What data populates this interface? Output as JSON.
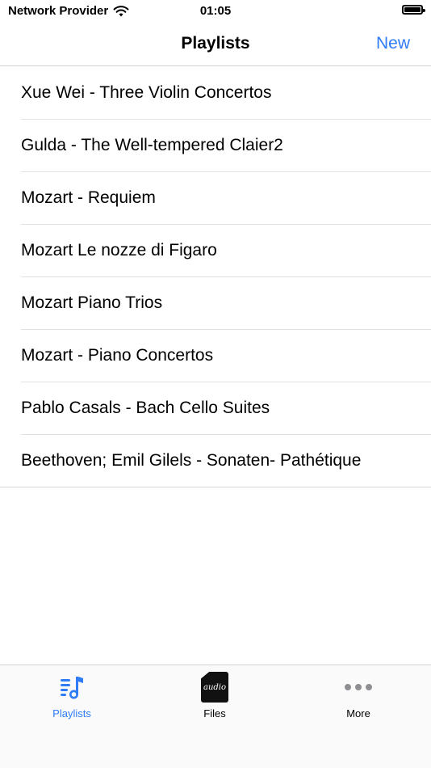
{
  "status_bar": {
    "carrier": "Network Provider",
    "time": "01:05"
  },
  "nav": {
    "title": "Playlists",
    "new_label": "New"
  },
  "playlists": [
    "Xue Wei - Three Violin Concertos",
    "Gulda - The Well-tempered Claier2",
    "Mozart - Requiem",
    "Mozart Le nozze di Figaro",
    "Mozart Piano Trios",
    "Mozart - Piano Concertos",
    "Pablo Casals - Bach Cello Suites",
    "Beethoven; Emil Gilels - Sonaten- Pathétique"
  ],
  "tabs": {
    "playlists": "Playlists",
    "files": "Files",
    "files_badge": "audio",
    "more": "More"
  },
  "colors": {
    "accent": "#2f7cf6"
  },
  "icons": {
    "wifi": "wifi-icon",
    "battery": "battery-icon",
    "playlists": "music-list-icon",
    "files": "audio-file-icon",
    "more": "more-dots-icon"
  }
}
